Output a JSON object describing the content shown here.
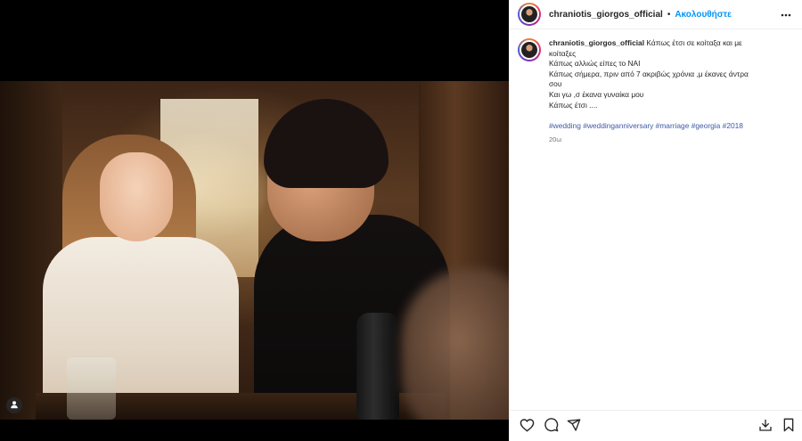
{
  "post": {
    "username": "chraniotis_giorgos_official",
    "follow_label": "Ακολουθήστε",
    "separator": "•",
    "caption_lines": [
      "Κάπως έτσι σε κοίταξα και με",
      "κοίταξες",
      "Κάπως αλλιώς είπες το ΝΑΙ",
      "Κάπως σήμερα, πριν από 7 ακριβώς χρόνια ,μ έκανες άντρα",
      "σου",
      "Και γω ,σ έκανα γυναίκα μου",
      "Κάπως έτσι ...."
    ],
    "hashtags": [
      "#wedding",
      "#weddinganniversary",
      "#marriage",
      "#georgia",
      "#2018"
    ],
    "time_ago": "20ω"
  },
  "icons": {
    "more": "more-horizontal-icon",
    "tag": "user-tag-icon",
    "like": "heart-icon",
    "comment": "comment-icon",
    "share": "send-icon",
    "download": "download-icon",
    "save": "bookmark-icon"
  },
  "colors": {
    "accent": "#0095f6",
    "hashtag": "#3f5aa8",
    "muted": "#737373",
    "text": "#262626"
  }
}
